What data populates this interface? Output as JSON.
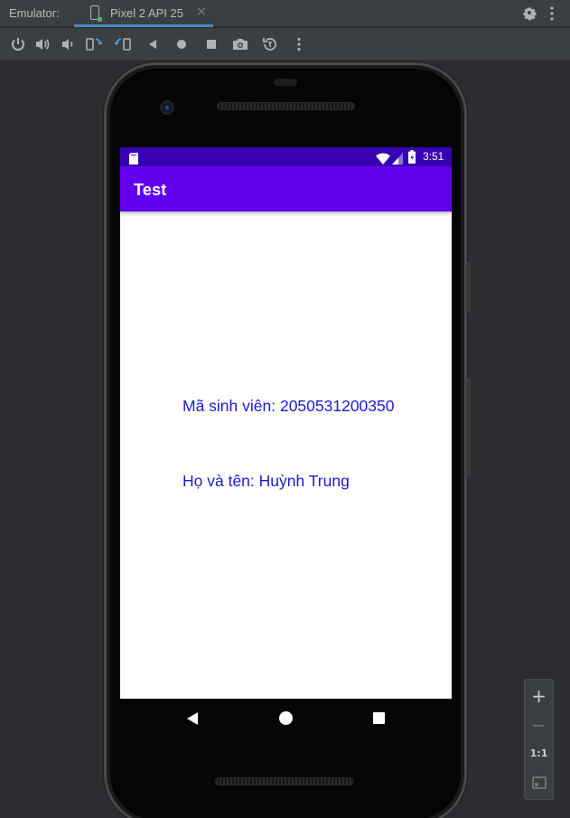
{
  "window": {
    "panel_label": "Emulator:",
    "tab_label": "Pixel 2 API 25",
    "tab_close_glyph": "×",
    "icons": [
      "device-icon",
      "settings-icon",
      "more-icon"
    ]
  },
  "toolbar": {
    "buttons": [
      {
        "name": "power-button",
        "icon": "power-icon"
      },
      {
        "name": "volume-up-button",
        "icon": "volume-up-icon"
      },
      {
        "name": "volume-down-button",
        "icon": "volume-down-icon"
      },
      {
        "name": "rotate-left-button",
        "icon": "rotate-left-icon"
      },
      {
        "name": "rotate-right-button",
        "icon": "rotate-right-icon"
      },
      {
        "name": "back-button",
        "icon": "back-triangle-icon"
      },
      {
        "name": "home-button",
        "icon": "home-circle-icon"
      },
      {
        "name": "overview-button",
        "icon": "overview-square-icon"
      },
      {
        "name": "screenshot-button",
        "icon": "camera-icon"
      },
      {
        "name": "snapshot-button",
        "icon": "snapshot-icon"
      },
      {
        "name": "more-button",
        "icon": "more-vertical-icon"
      }
    ]
  },
  "device": {
    "status_bar": {
      "time": "3:51",
      "color": "#3700b3",
      "icons": [
        "sd-card-icon",
        "wifi-icon",
        "signal-icon",
        "battery-icon"
      ]
    },
    "app_bar": {
      "title": "Test",
      "color": "#6200ee"
    },
    "content": {
      "student_id_line": "Mã sinh viên: 2050531200350",
      "name_line": "Họ và tên: Huỳnh Trung",
      "text_color": "#1a1ad6"
    },
    "nav_bar": {
      "icons": [
        "back-icon",
        "home-icon",
        "recent-apps-icon"
      ]
    }
  },
  "zoom_controls": {
    "zoom_in": "+",
    "zoom_out": "−",
    "actual_size": "1:1",
    "fit_icon": "fit-screen-icon"
  }
}
